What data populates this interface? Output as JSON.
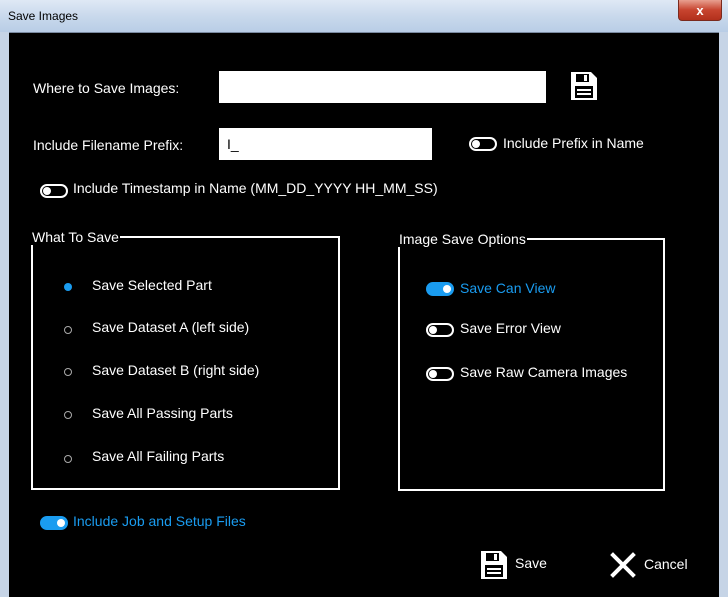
{
  "window": {
    "title": "Save Images",
    "close_glyph": "x"
  },
  "where_to_save": {
    "label": "Where to Save Images:",
    "value": "",
    "icon": "floppy-disk-icon"
  },
  "prefix": {
    "label": "Include Filename Prefix:",
    "value": "I_"
  },
  "include_prefix_in_name": {
    "label": "Include Prefix in Name",
    "on": false
  },
  "include_timestamp": {
    "label": "Include Timestamp in Name (MM_DD_YYYY HH_MM_SS)",
    "on": false
  },
  "what_to_save": {
    "legend": "What To Save",
    "options": [
      {
        "label": "Save Selected Part",
        "selected": true
      },
      {
        "label": "Save Dataset A (left side)",
        "selected": false
      },
      {
        "label": "Save Dataset B (right side)",
        "selected": false
      },
      {
        "label": "Save All Passing Parts",
        "selected": false
      },
      {
        "label": "Save All Failing Parts",
        "selected": false
      }
    ]
  },
  "image_save_options": {
    "legend": "Image Save Options",
    "toggles": [
      {
        "label": "Save Can View",
        "on": true
      },
      {
        "label": "Save Error View",
        "on": false
      },
      {
        "label": "Save Raw Camera Images",
        "on": false
      }
    ]
  },
  "include_job_setup": {
    "label": "Include Job and Setup Files",
    "on": true
  },
  "buttons": {
    "save_label": "Save",
    "cancel_label": "Cancel"
  },
  "colors": {
    "accent": "#1a9cf0",
    "background": "#000000",
    "text": "#ffffff"
  }
}
